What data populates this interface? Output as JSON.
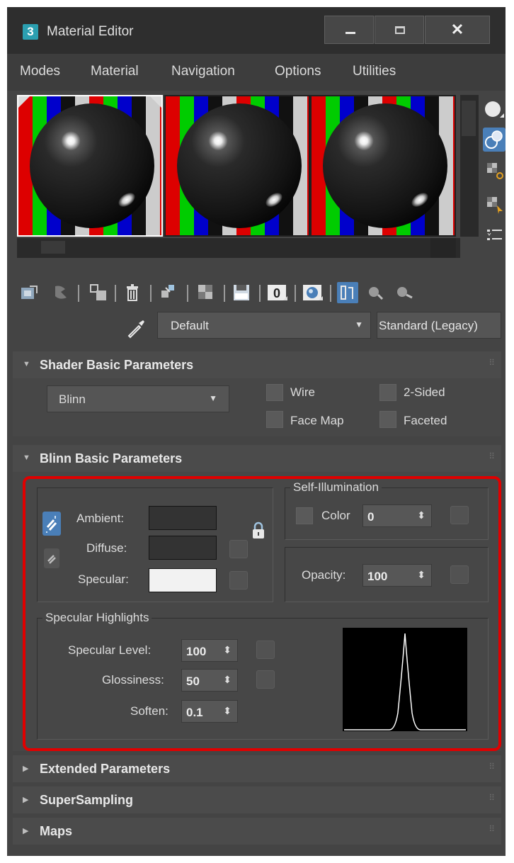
{
  "window": {
    "app_icon_label": "3",
    "title": "Material Editor",
    "close_glyph": "✕"
  },
  "menu": [
    {
      "label": "Modes"
    },
    {
      "label": "Material"
    },
    {
      "label": "Navigation"
    },
    {
      "label": "Options"
    },
    {
      "label": "Utilities"
    }
  ],
  "material": {
    "name": "Default",
    "type": "Standard (Legacy)"
  },
  "shader_basic": {
    "title": "Shader Basic Parameters",
    "shader": "Blinn",
    "wire_label": "Wire",
    "two_sided_label": "2-Sided",
    "face_map_label": "Face Map",
    "faceted_label": "Faceted"
  },
  "blinn_basic": {
    "title": "Blinn Basic Parameters",
    "ambient_label": "Ambient:",
    "diffuse_label": "Diffuse:",
    "specular_label": "Specular:",
    "ambient_color": "#333333",
    "diffuse_color": "#333333",
    "specular_color": "#f2f2f2",
    "self_illum_title": "Self-Illumination",
    "self_illum_color_label": "Color",
    "self_illum_value": "0",
    "opacity_label": "Opacity:",
    "opacity_value": "100",
    "spec_highlights_title": "Specular Highlights",
    "spec_level_label": "Specular Level:",
    "spec_level_value": "100",
    "glossiness_label": "Glossiness:",
    "glossiness_value": "50",
    "soften_label": "Soften:",
    "soften_value": "0.1"
  },
  "collapsed_rollouts": [
    {
      "title": "Extended Parameters"
    },
    {
      "title": "SuperSampling"
    },
    {
      "title": "Maps"
    }
  ],
  "colors": {
    "highlight_border": "#e00000",
    "active_icon_bg": "#4a7fb8"
  }
}
